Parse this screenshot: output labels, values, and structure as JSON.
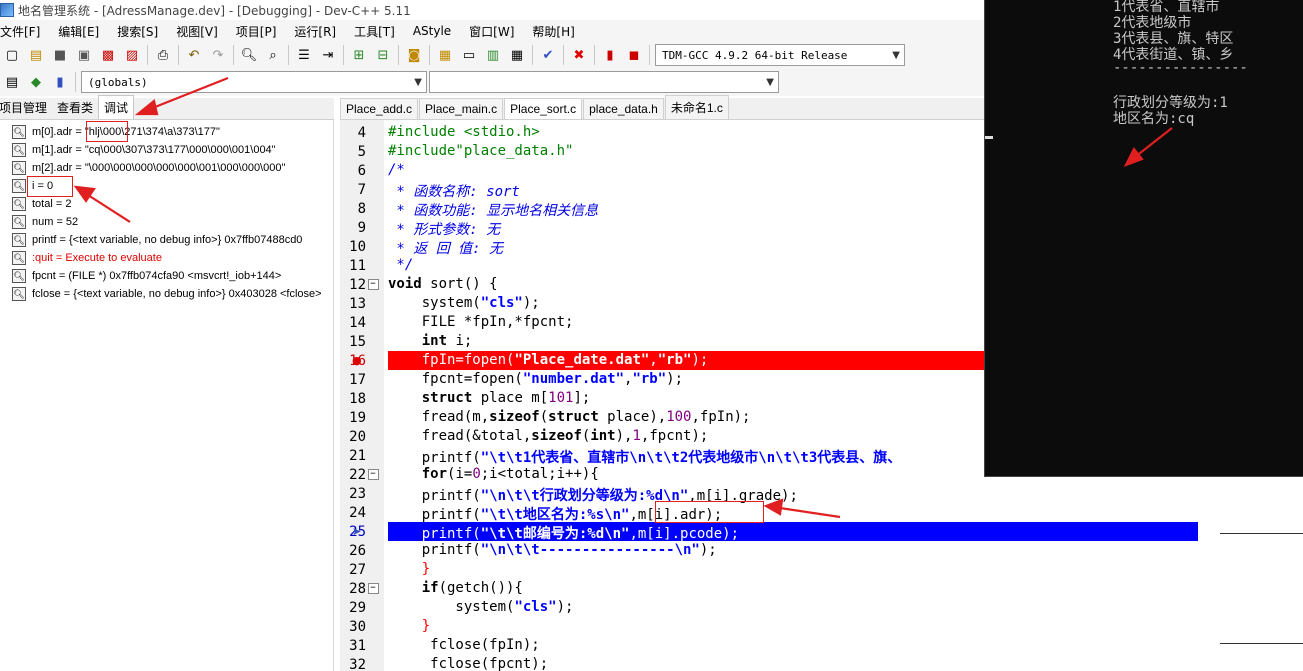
{
  "window": {
    "title": "地名管理系统 - [AdressManage.dev] - [Debugging] - Dev-C++ 5.11"
  },
  "menu": [
    "文件[F]",
    "编辑[E]",
    "搜索[S]",
    "视图[V]",
    "项目[P]",
    "运行[R]",
    "工具[T]",
    "AStyle",
    "窗口[W]",
    "帮助[H]"
  ],
  "toolbar": {
    "compiler": "TDM-GCC 4.9.2 64-bit Release",
    "scope": "(globals)",
    "member": ""
  },
  "left_tabs": [
    "项目管理",
    "查看类",
    "调试"
  ],
  "watches": [
    {
      "text": "m[0].adr = \"hlj\\000\\271\\374\\a\\373\\177\"",
      "red": false
    },
    {
      "text": "m[1].adr = \"cq\\000\\307\\373\\177\\000\\000\\001\\004\"",
      "red": false
    },
    {
      "text": "m[2].adr = \"\\000\\000\\000\\000\\000\\001\\000\\000\\000\"",
      "red": false
    },
    {
      "text": "i = 0",
      "red": false
    },
    {
      "text": "total = 2",
      "red": false
    },
    {
      "text": "num = 52",
      "red": false
    },
    {
      "text": "printf = {<text variable, no debug info>} 0x7ffb07488cd0",
      "red": false
    },
    {
      "text": ":quit = Execute to evaluate",
      "red": true
    },
    {
      "text": "fpcnt = (FILE *) 0x7ffb074cfa90 <msvcrt!_iob+144>",
      "red": false
    },
    {
      "text": "fclose = {<text variable, no debug info>} 0x403028 <fclose>",
      "red": false
    }
  ],
  "editor_tabs": [
    "Place_add.c",
    "Place_main.c",
    "Place_sort.c",
    "place_data.h",
    "未命名1.c"
  ],
  "line_numbers": [
    "4",
    "5",
    "6",
    "7",
    "8",
    "9",
    "10",
    "11",
    "12",
    "13",
    "14",
    "15",
    "16",
    "17",
    "18",
    "19",
    "20",
    "21",
    "22",
    "23",
    "24",
    "25",
    "26",
    "27",
    "28",
    "29",
    "30",
    "31",
    "32"
  ],
  "code_text": {
    "l4": "#include <stdio.h>",
    "l5": "#include\"place_data.h\"",
    "l6": "/*",
    "l7": " * 函数名称: sort",
    "l8": " * 函数功能: 显示地名相关信息",
    "l9": " * 形式参数: 无",
    "l10": " * 返 回 值: 无",
    "l11": " */",
    "l12_kw": "void",
    "l12_rest": " sort() {",
    "l13_a": "    system(",
    "l13_s": "\"cls\"",
    "l13_b": ");",
    "l14_a": "    FILE *fpIn,*fpcnt;",
    "l15_kw": "    int",
    "l15_rest": " i;",
    "l16_a": "    fpIn=fopen(",
    "l16_s1": "\"Place_date.dat\"",
    "l16_c": ",",
    "l16_s2": "\"rb\"",
    "l16_b": ");",
    "l17_a": "    fpcnt=fopen(",
    "l17_s1": "\"number.dat\"",
    "l17_c": ",",
    "l17_s2": "\"rb\"",
    "l17_b": ");",
    "l18_kw": "    struct",
    "l18_rest": " place m[",
    "l18_n": "101",
    "l18_end": "];",
    "l19_a": "    fread(m,",
    "l19_kw1": "sizeof",
    "l19_b": "(",
    "l19_kw2": "struct",
    "l19_c": " place),",
    "l19_n": "100",
    "l19_d": ",fpIn);",
    "l20_a": "    fread(&total,",
    "l20_kw1": "sizeof",
    "l20_b": "(",
    "l20_kw2": "int",
    "l20_c": "),",
    "l20_n": "1",
    "l20_d": ",fpcnt);",
    "l21_a": "    printf(",
    "l21_s": "\"\\t\\t1代表省、直辖市\\n\\t\\t2代表地级市\\n\\t\\t3代表县、旗、",
    "l22_kw": "    for",
    "l22_a": "(i=",
    "l22_n1": "0",
    "l22_b": ";i<total;i++){",
    "l23_a": "    printf(",
    "l23_s": "\"\\n\\t\\t行政划分等级为:%d\\n\"",
    "l23_b": ",m[i].grade);",
    "l24_a": "    printf(",
    "l24_s": "\"\\t\\t地区名为:%s\\n\"",
    "l24_b": ",m[i].adr);",
    "l25_a": "    printf(",
    "l25_s": "\"\\t\\t邮编号为:%d\\n\"",
    "l25_b": ",m[i].pcode);",
    "l26_a": "    printf(",
    "l26_s": "\"\\n\\t\\t----------------\\n\"",
    "l26_b": ");",
    "l27": "    }",
    "l28_kw": "    if",
    "l28_a": "(getch()){",
    "l29_a": "        system(",
    "l29_s": "\"cls\"",
    "l29_b": ");",
    "l30": "    }",
    "l31": "     fclose(fpIn);",
    "l32": "     fclose(fpcnt);"
  },
  "console": {
    "lines": [
      "1代表省、直辖市",
      "2代表地级市",
      "3代表县、旗、特区",
      "4代表街道、镇、乡",
      "----------------",
      "",
      "行政划分等级为:1",
      "地区名为:cq"
    ]
  },
  "colors": {
    "breakpoint_line": "#ff0000",
    "exec_line": "#0000ff",
    "annotation": "#e02020",
    "console_bg": "#0c0c0c"
  }
}
